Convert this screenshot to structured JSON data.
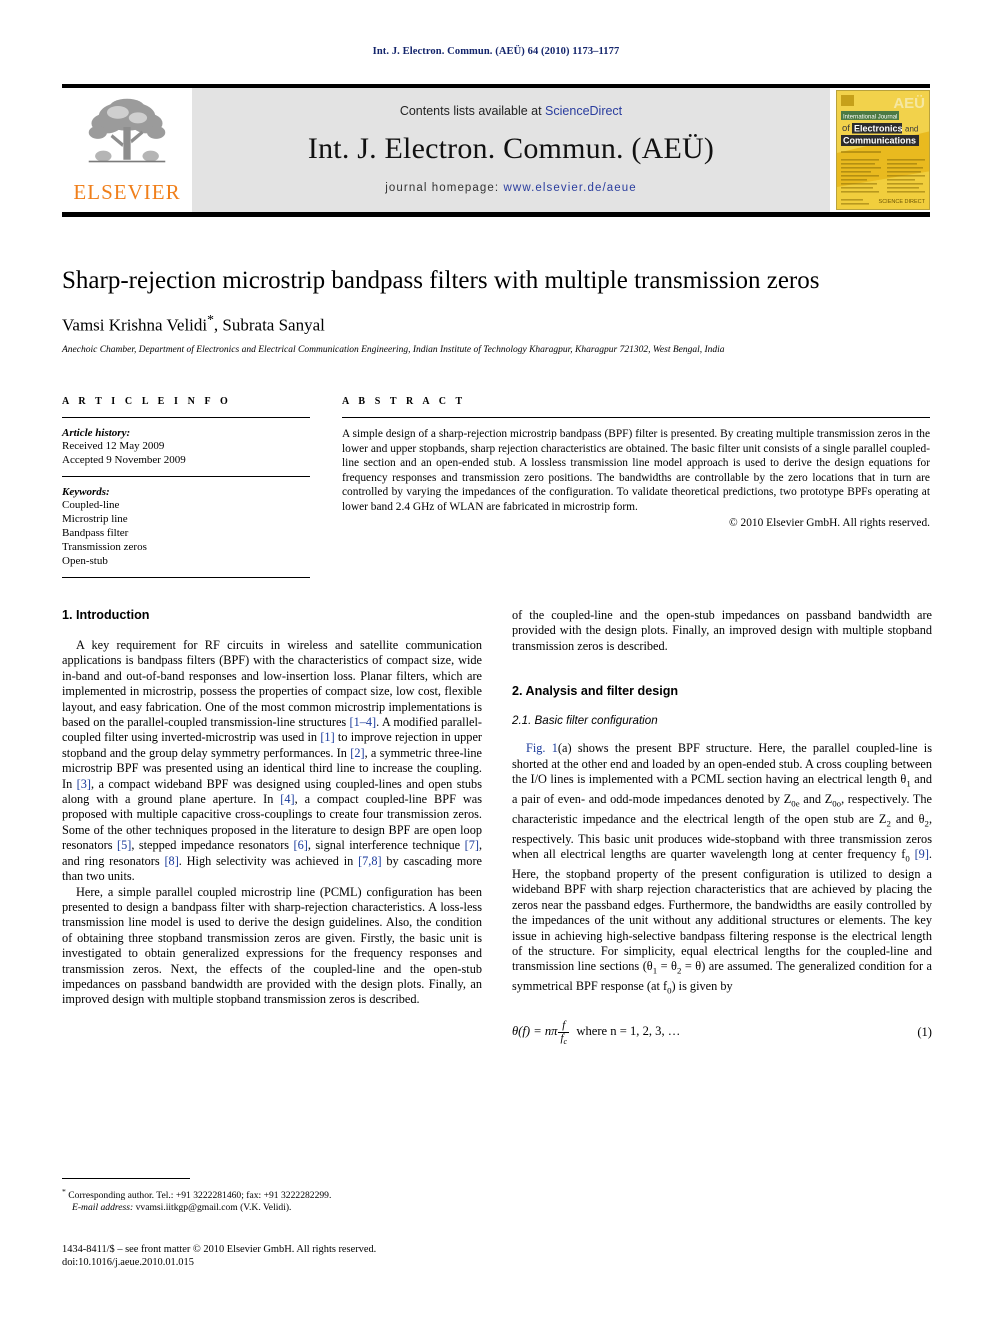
{
  "running_head": "Int. J. Electron. Commun. (AEÜ) 64 (2010) 1173–1177",
  "banner": {
    "contents_prefix": "Contents lists available at ",
    "contents_link": "ScienceDirect",
    "journal_title": "Int. J. Electron. Commun. (AEÜ)",
    "homepage_prefix": "journal homepage: ",
    "homepage_url": "www.elsevier.de/aeue",
    "publisher_logo_word": "ELSEVIER",
    "publisher_logo_icon": "elsevier-tree-icon",
    "cover_icon": "journal-cover-thumbnail",
    "cover_title_line1": "International Journal",
    "cover_title_line2": "of Electronics and",
    "cover_title_line3": "Communications",
    "cover_mark": "AEÜ",
    "accent_link_color": "#2a3d9e",
    "logo_color": "#f07f1a",
    "banner_bg": "#e3e3e3"
  },
  "article": {
    "title": "Sharp-rejection microstrip bandpass filters with multiple transmission zeros",
    "authors": "Vamsi Krishna Velidi",
    "authors_star": "*",
    "authors_rest": ", Subrata Sanyal",
    "affiliation": "Anechoic Chamber, Department of Electronics and Electrical Communication Engineering, Indian Institute of Technology Kharagpur, Kharagpur 721302, West Bengal, India"
  },
  "article_info": {
    "heading": "A R T I C L E    I N F O",
    "history_label": "Article history:",
    "history": [
      "Received 12 May 2009",
      "Accepted 9 November 2009"
    ],
    "keywords_label": "Keywords:",
    "keywords": [
      "Coupled-line",
      "Microstrip line",
      "Bandpass filter",
      "Transmission zeros",
      "Open-stub"
    ]
  },
  "abstract": {
    "heading": "A B S T R A C T",
    "text": "A simple design of a sharp-rejection microstrip bandpass (BPF) filter is presented. By creating multiple transmission zeros in the lower and upper stopbands, sharp rejection characteristics are obtained. The basic filter unit consists of a single parallel coupled-line section and an open-ended stub. A lossless transmission line model approach is used to derive the design equations for frequency responses and transmission zero positions. The bandwidths are controllable by the zero locations that in turn are controlled by varying the impedances of the configuration. To validate theoretical predictions, two prototype BPFs operating at lower band 2.4 GHz of WLAN are fabricated in microstrip form.",
    "copyright": "© 2010 Elsevier GmbH. All rights reserved."
  },
  "body": {
    "section1_heading": "1.  Introduction",
    "p1_a": "A key requirement for RF circuits in wireless and satellite communication applications is bandpass filters (BPF) with the characteristics of compact size, wide in-band and out-of-band responses and low-insertion loss. Planar filters, which are implemented in microstrip, possess the properties of compact size, low cost, flexible layout, and easy fabrication. One of the most common microstrip implementations is based on the parallel-coupled transmission-line structures ",
    "p1_ref1": "[1–4]",
    "p1_b": ". A modified parallel-coupled filter using inverted-microstrip was used in ",
    "p1_ref2": "[1]",
    "p1_c": " to improve rejection in upper stopband and the group delay symmetry performances. In ",
    "p1_ref3": "[2]",
    "p1_d": ", a symmetric three-line microstrip BPF was presented using an identical third line to increase the coupling. In ",
    "p1_ref4": "[3]",
    "p1_e": ", a compact wideband BPF was designed using coupled-lines and open stubs along with a ground plane aperture. In ",
    "p1_ref5": "[4]",
    "p1_f": ", a compact coupled-line BPF was proposed with multiple capacitive cross-couplings to create four transmission zeros. Some of the other techniques proposed in the literature to design BPF are open loop resonators ",
    "p1_ref6": "[5]",
    "p1_g": ", stepped impedance resonators ",
    "p1_ref7": "[6]",
    "p1_h": ", signal interference technique ",
    "p1_ref8": "[7]",
    "p1_i": ", and ring resonators ",
    "p1_ref9": "[8]",
    "p1_j": ". High selectivity was achieved in ",
    "p1_ref10": "[7,8]",
    "p1_k": " by cascading more than two units.",
    "p2": "Here, a simple parallel coupled microstrip line (PCML) configuration has been presented to design a bandpass filter with sharp-rejection characteristics. A loss-less transmission line model is used to derive the design guidelines. Also, the condition of obtaining three stopband transmission zeros are given. Firstly, the basic unit is investigated to obtain generalized expressions for the frequency responses and transmission zeros. Next, the effects of the coupled-line and the open-stub impedances on passband bandwidth are provided with the design plots. Finally, an improved design with multiple stopband transmission zeros is described.",
    "p2_right": "of the coupled-line and the open-stub impedances on passband bandwidth are provided with the design plots. Finally, an improved design with multiple stopband transmission zeros is described.",
    "section2_heading": "2.  Analysis and filter design",
    "subsection21_heading": "2.1.  Basic filter configuration",
    "p3_a": "Fig. 1",
    "p3_b": "(a) shows the present BPF structure. Here, the parallel coupled-line is shorted at the other end and loaded by an open-ended stub. A cross coupling between the I/O lines is implemented with a PCML section having an electrical length θ",
    "p3_sub1": "1",
    "p3_c": " and a pair of even- and odd-mode impedances denoted by Z",
    "p3_sub2": "0e",
    "p3_d": " and Z",
    "p3_sub3": "0o",
    "p3_e": ", respectively. The characteristic impedance and the electrical length of the open stub are Z",
    "p3_sub4": "2",
    "p3_f": " and θ",
    "p3_sub5": "2",
    "p3_g": ", respectively. This basic unit produces wide-stopband with three transmission zeros when all electrical lengths are quarter wavelength long at center frequency f",
    "p3_sub6": "0",
    "p3_h": " ",
    "p3_ref": "[9]",
    "p3_i": ". Here, the stopband property of the present configuration is utilized to design a wideband BPF with sharp rejection characteristics that are achieved by placing the zeros near the passband edges. Furthermore, the bandwidths are easily controlled by the impedances of the unit without any additional structures or elements. The key issue in achieving high-selective bandpass filtering response is the electrical length of the structure. For simplicity, equal electrical lengths for the coupled-line and transmission line sections (θ",
    "p3_sub7": "1",
    "p3_j": " = θ",
    "p3_sub8": "2",
    "p3_k": " = θ) are assumed. The generalized condition for a symmetrical BPF response (at f",
    "p3_sub9": "0",
    "p3_l": ") is given by"
  },
  "equation": {
    "lhs": "θ(f) = nπ",
    "frac_num": "f",
    "frac_den": "f",
    "frac_den_sub": "c",
    "condition": "where n = 1, 2, 3, …",
    "number": "(1)"
  },
  "footnotes": {
    "corresponding": "Corresponding author. Tel.: +91 3222281460; fax: +91 3222282299.",
    "email_label": "E-mail address:",
    "email": "vvamsi.iitkgp@gmail.com (V.K. Velidi).",
    "imprint_line1": "1434-8411/$ – see front matter © 2010 Elsevier GmbH. All rights reserved.",
    "imprint_line2": "doi:10.1016/j.aeue.2010.01.015"
  }
}
